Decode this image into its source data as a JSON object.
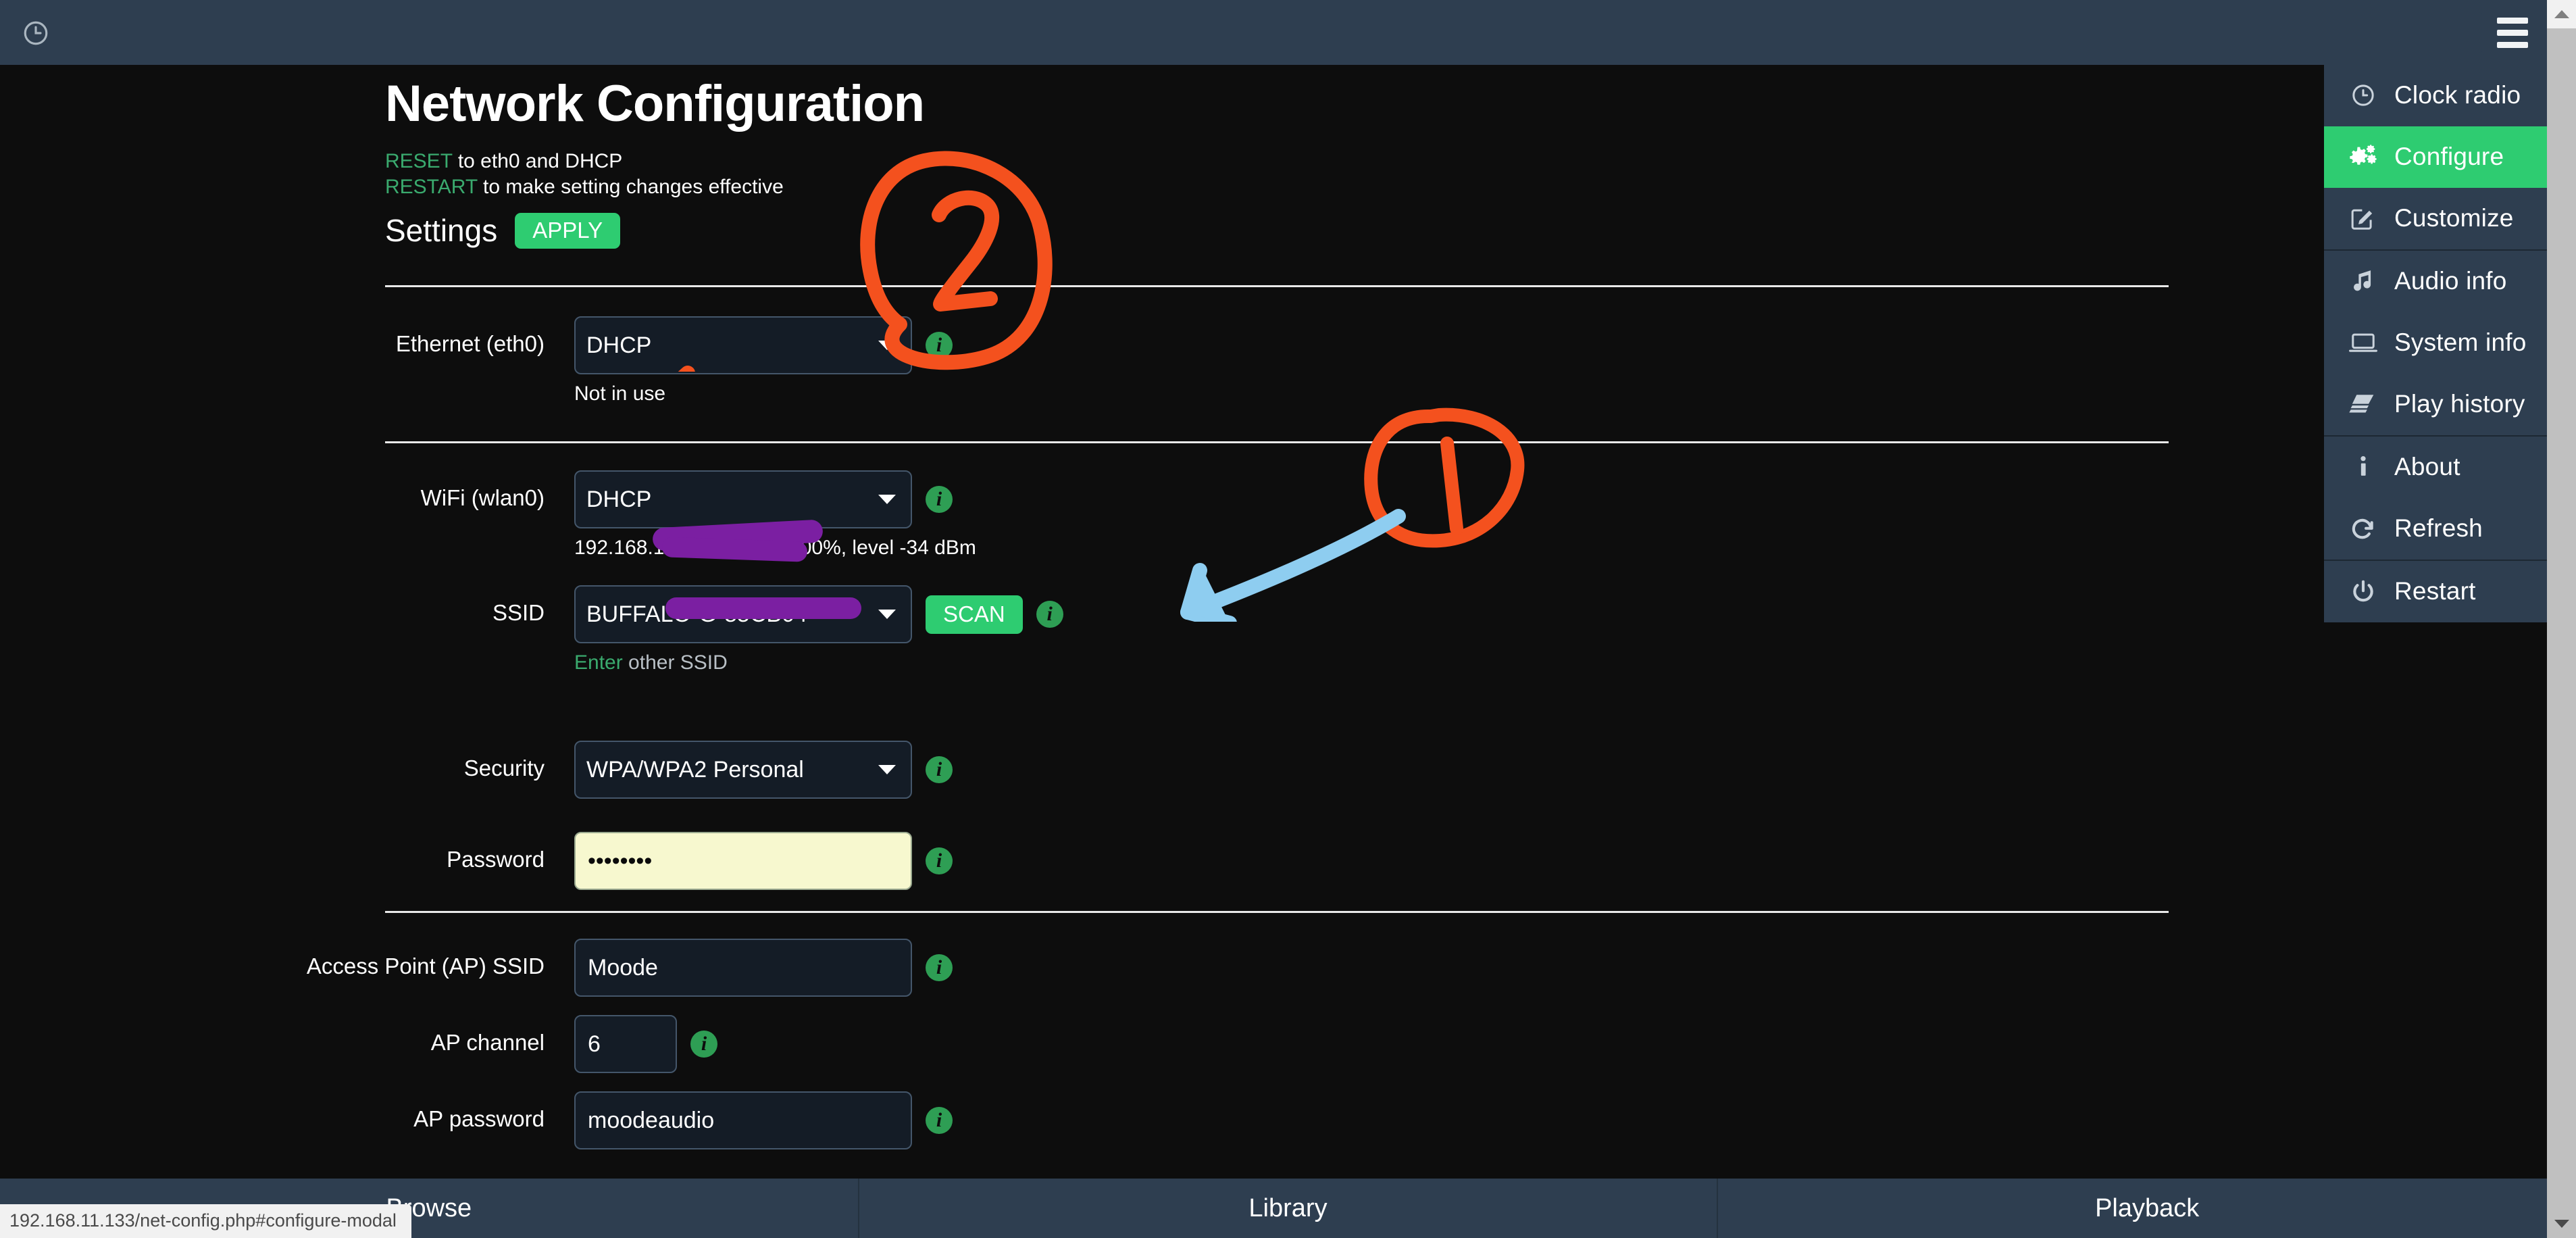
{
  "topbar": {
    "clock_icon": "clock-icon",
    "menu_icon": "hamburger-icon"
  },
  "menu": {
    "items": [
      {
        "label": "Clock radio",
        "icon": "clock-icon",
        "active": false
      },
      {
        "label": "Configure",
        "icon": "gears-icon",
        "active": true
      },
      {
        "label": "Customize",
        "icon": "pencil-square-icon",
        "active": false
      },
      {
        "label": "Audio info",
        "icon": "music-note-icon",
        "active": false
      },
      {
        "label": "System info",
        "icon": "laptop-icon",
        "active": false
      },
      {
        "label": "Play history",
        "icon": "book-icon",
        "active": false
      },
      {
        "label": "About",
        "icon": "info-icon",
        "active": false
      },
      {
        "label": "Refresh",
        "icon": "refresh-icon",
        "active": false
      },
      {
        "label": "Restart",
        "icon": "power-icon",
        "active": false
      }
    ]
  },
  "page": {
    "title": "Network Configuration",
    "hint_line1_key": "RESET",
    "hint_line1_rest": " to eth0 and DHCP",
    "hint_line2_key": "RESTART",
    "hint_line2_rest": " to make setting changes effective",
    "settings_label": "Settings",
    "apply_label": "APPLY"
  },
  "form": {
    "ethernet": {
      "label": "Ethernet (eth0)",
      "value": "DHCP",
      "status": "Not in use",
      "info_icon": "info-icon"
    },
    "wifi": {
      "label": "WiFi (wlan0)",
      "value": "DHCP",
      "status": "192.168.11.133, quality 100%, level -34 dBm",
      "info_icon": "info-icon"
    },
    "ssid": {
      "label": "SSID",
      "value": "BUFFALO-G-85CB04",
      "scan_label": "SCAN",
      "helper_link": "Enter other SSID",
      "helper_link_text": "Enter",
      "helper_rest": " other SSID",
      "info_icon": "info-icon"
    },
    "security": {
      "label": "Security",
      "value": "WPA/WPA2 Personal",
      "info_icon": "info-icon"
    },
    "password": {
      "label": "Password",
      "value": "••••••••",
      "info_icon": "info-icon"
    },
    "ap_ssid": {
      "label": "Access Point (AP) SSID",
      "value": "Moode",
      "info_icon": "info-icon"
    },
    "ap_channel": {
      "label": "AP channel",
      "value": "6",
      "info_icon": "info-icon"
    },
    "ap_password": {
      "label": "AP password",
      "value": "moodeaudio",
      "info_icon": "info-icon"
    }
  },
  "bottom_nav": {
    "tabs": [
      {
        "label": "Browse"
      },
      {
        "label": "Library"
      },
      {
        "label": "Playback"
      }
    ]
  },
  "status_url": "192.168.11.133/net-config.php#configure-modal",
  "annotations": [
    {
      "number": "1",
      "color": "#f4511e",
      "arrow_color": "#8ecdf0"
    },
    {
      "number": "2",
      "color": "#f4511e",
      "arrow_color": "#f4511e"
    }
  ],
  "colors": {
    "accent_green": "#2ecc71",
    "header_navy": "#2e3e50",
    "page_bg": "#0d0d0d",
    "annotation_orange": "#f4511e",
    "annotation_blue": "#8ecdf0",
    "redaction_purple": "#7b1fa2",
    "autofill_yellow": "#f7f8cf"
  }
}
